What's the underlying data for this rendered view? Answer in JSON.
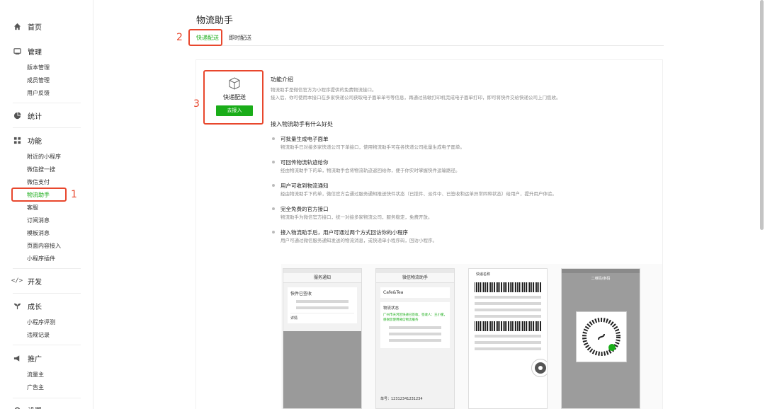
{
  "sidebar": {
    "home": "首页",
    "manage": {
      "label": "管理",
      "items": [
        "版本管理",
        "成员管理",
        "用户反馈"
      ]
    },
    "stats": "统计",
    "features": {
      "label": "功能",
      "items": [
        "附近的小程序",
        "微信搜一搜",
        "微信支付",
        "物流助手",
        "客服",
        "订阅消息",
        "模板消息",
        "页面内容接入",
        "小程序插件"
      ]
    },
    "dev": "开发",
    "growth": {
      "label": "成长",
      "items": [
        "小程序评测",
        "违规记录"
      ]
    },
    "promo": {
      "label": "推广",
      "items": [
        "流量主",
        "广告主"
      ]
    },
    "settings": "设置"
  },
  "annotations": {
    "n1": "1",
    "n2": "2",
    "n3": "3"
  },
  "page": {
    "title": "物流助手",
    "tabs": [
      "快递配送",
      "即时配送"
    ]
  },
  "card": {
    "title": "快递配送",
    "button": "去接入"
  },
  "intro": {
    "heading": "功能介绍",
    "line1": "物流助手是微信官方为小程序提供的免费物流接口。",
    "line2": "接入后，你可使用本接口在多家快递公司获取电子面单单号等信息，再通过热敏打印机完成电子面单打印，即可将快件交给快递公司上门揽收。"
  },
  "benefits": {
    "heading": "接入物流助手有什么好处",
    "items": [
      {
        "title": "可批量生成电子面单",
        "desc": "物流助手已对接多家快递公司下单接口，使用物流助手可在各快递公司批量生成电子面单。"
      },
      {
        "title": "可回传物流轨迹给你",
        "desc": "经由物流助手下的单，物流助手会将物流轨迹返回给你，便于你实时掌握快件运输路径。"
      },
      {
        "title": "用户可收到物流通知",
        "desc": "经由物流助手下的单，微信官方会通过服务通知推送快件状态（已揽件、派件中、已签收和运单异常四种状态）给用户，提升用户体验。"
      },
      {
        "title": "完全免费的官方接口",
        "desc": "物流助手为微信官方接口，统一对接多家物流公司，服务稳定，免费开放。"
      },
      {
        "title": "接入物流助手后，用户可通过两个方式回访你的小程序",
        "desc": "用户可通过微信服务通知发送的物流消息，或快递单小程序码，回访小程序。"
      }
    ]
  },
  "phones": {
    "p1_title": "服务通知",
    "p1_card_title": "快件已签收",
    "p1_detail": "详情",
    "p2_title": "微信物流助手",
    "p2_shop": "Cafe&Tea",
    "p2_status": "物流状态",
    "p2_track": "广州市天河区快递已签收，签收人：王小蜜，感谢您使用微信物流服务",
    "p2_order": "单号：12312341231234",
    "p3_company": "快递名称",
    "p4_title": "二维码/条码"
  },
  "colors": {
    "accent": "#1aad19",
    "annotation": "#e8472d"
  }
}
